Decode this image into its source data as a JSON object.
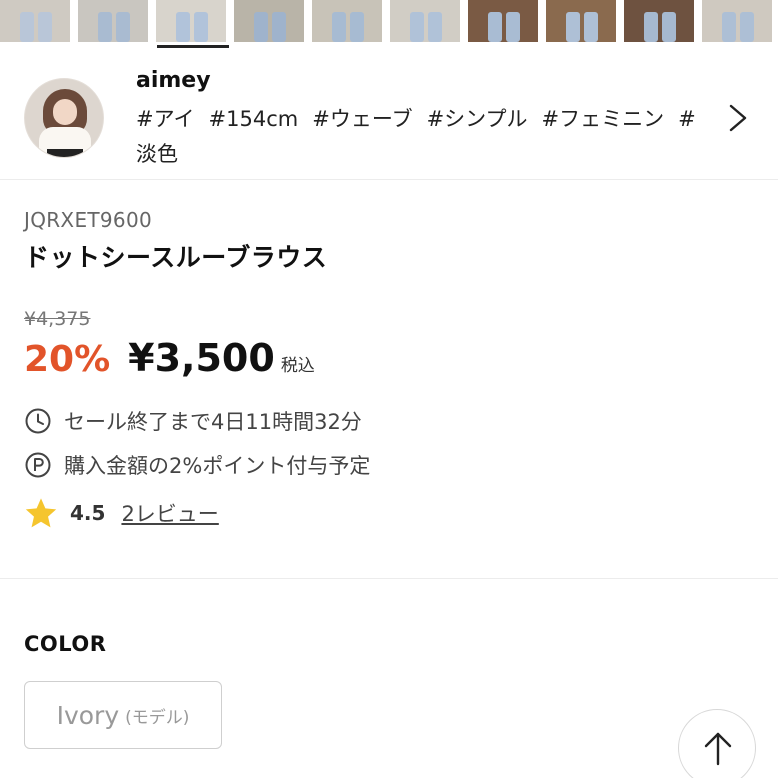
{
  "thumbnails": [
    {
      "name": "thumb-1",
      "bg": "#cfcac2",
      "leg": "#b9c6d8"
    },
    {
      "name": "thumb-2",
      "bg": "#c9c6c0",
      "leg": "#a9bbd1"
    },
    {
      "name": "thumb-3",
      "bg": "#d8d4cc",
      "leg": "#b1c3da",
      "active": true
    },
    {
      "name": "thumb-4",
      "bg": "#b9b4a8",
      "leg": "#9fb3cc"
    },
    {
      "name": "thumb-5",
      "bg": "#c8c3b8",
      "leg": "#a7bbd2"
    },
    {
      "name": "thumb-6",
      "bg": "#d1cdc5",
      "leg": "#b0c2d8"
    },
    {
      "name": "thumb-7",
      "bg": "#7a5a44",
      "leg": "#a9bcd3"
    },
    {
      "name": "thumb-8",
      "bg": "#8a6a4e",
      "leg": "#aec0d6"
    },
    {
      "name": "thumb-9",
      "bg": "#6e5240",
      "leg": "#a6b9d0"
    },
    {
      "name": "thumb-10",
      "bg": "#cfc9c0",
      "leg": "#adbfd5"
    }
  ],
  "stylist": {
    "name": "aimey",
    "tags": [
      "#アイ",
      "#154cm",
      "#ウェーブ",
      "#シンプル",
      "#フェミニン",
      "#淡色"
    ]
  },
  "product": {
    "sku": "JQRXET9600",
    "title": "ドットシースルーブラウス",
    "original_price": "¥4,375",
    "discount": "20%",
    "price": "¥3,500",
    "tax_label": "税込",
    "sale_remaining": "セール終了まで4日11時間32分",
    "points_note": "購入金額の2%ポイント付与予定",
    "rating": "4.5",
    "reviews_link": "2レビュー"
  },
  "color": {
    "label": "COLOR",
    "options": [
      {
        "name": "Ivory",
        "note": "(モデル)"
      }
    ]
  },
  "colors": {
    "accent_discount": "#e2542a",
    "star": "#f5c52e",
    "text": "#222222"
  }
}
